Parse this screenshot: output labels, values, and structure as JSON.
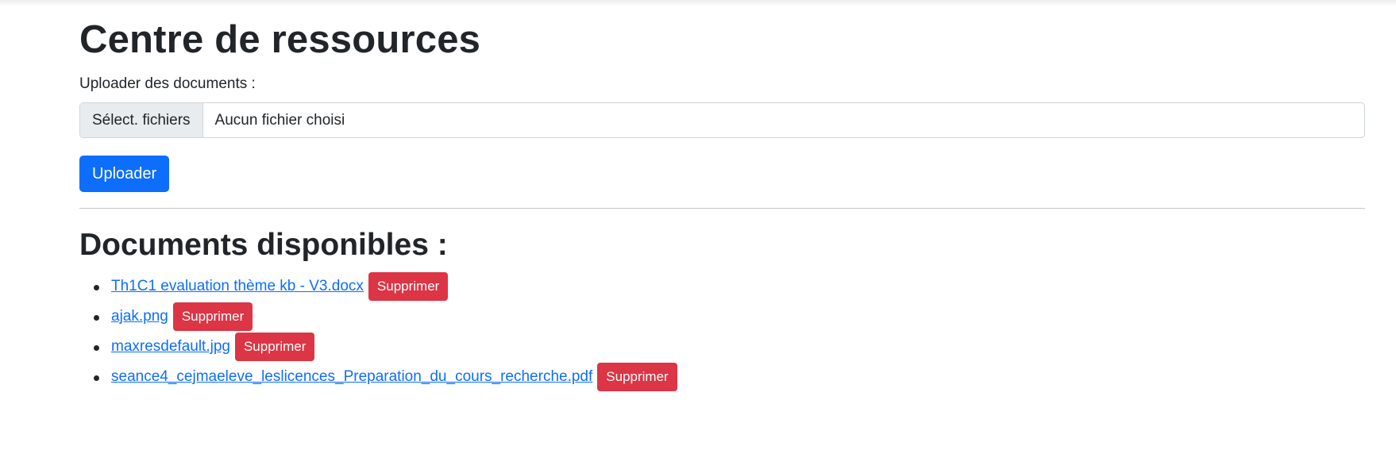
{
  "page": {
    "title": "Centre de ressources",
    "upload_label": "Uploader des documents :",
    "file_input": {
      "button_label": "Sélect. fichiers",
      "status_text": "Aucun fichier choisi"
    },
    "upload_button": "Uploader",
    "section_title": "Documents disponibles :"
  },
  "documents": [
    {
      "name": "Th1C1 evaluation thème kb - V3.docx",
      "delete_label": "Supprimer"
    },
    {
      "name": "ajak.png",
      "delete_label": "Supprimer"
    },
    {
      "name": "maxresdefault.jpg",
      "delete_label": "Supprimer"
    },
    {
      "name": "seance4_cejmaeleve_leslicences_Preparation_du_cours_recherche.pdf",
      "delete_label": "Supprimer"
    }
  ],
  "colors": {
    "primary": "#0d6efd",
    "danger": "#dc3545",
    "text": "#212529"
  }
}
